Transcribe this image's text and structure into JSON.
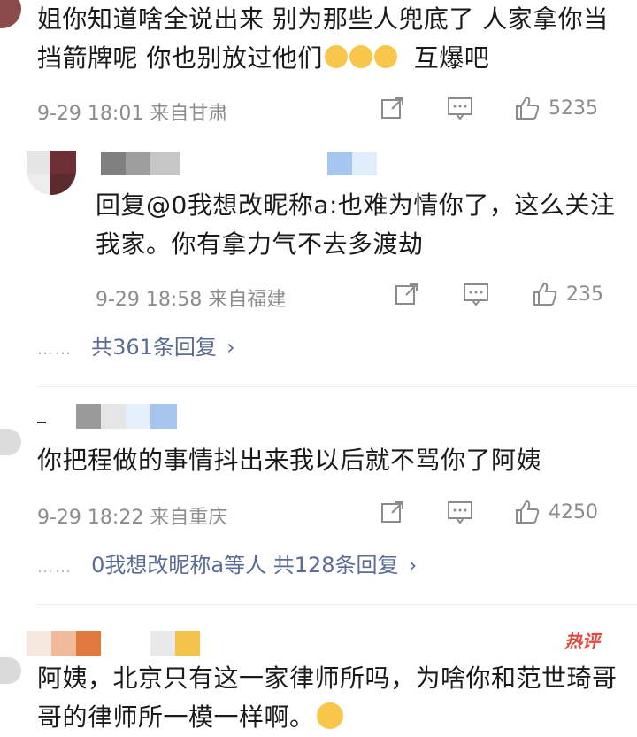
{
  "comments": [
    {
      "text": "姐你知道啥全说出来 别为那些人兜底了 人家拿你当挡箭牌呢 你也别放过他们",
      "tail": "互爆吧",
      "emoji_icons": [
        "grin-emoji-icon",
        "grin-emoji-icon",
        "grin-emoji-icon"
      ],
      "time": "9-29 18:01",
      "location": "来自甘肃",
      "likes": "5235"
    },
    {
      "text": "回复@0我想改昵称a:也难为情你了，这么关注我家。你有拿力气不去多渡劫",
      "time": "9-29 18:58",
      "location": "来自福建",
      "likes": "235",
      "replies_link": "共361条回复"
    },
    {
      "text": "你把程做的事情抖出来我以后就不骂你了阿姨",
      "time": "9-29 18:22",
      "location": "来自重庆",
      "likes": "4250",
      "replies_link": "0我想改昵称a等人  共128条回复"
    },
    {
      "badge": "热评",
      "text": "阿姨，北京只有这一家律师所吗，为啥你和范世琦哥哥的律师所一模一样啊。"
    }
  ],
  "reply_more_dots": "……",
  "chevron": "›",
  "colors": {
    "link": "#5a6c93",
    "meta": "#8c8c8c",
    "hot": "#e24a3f"
  }
}
